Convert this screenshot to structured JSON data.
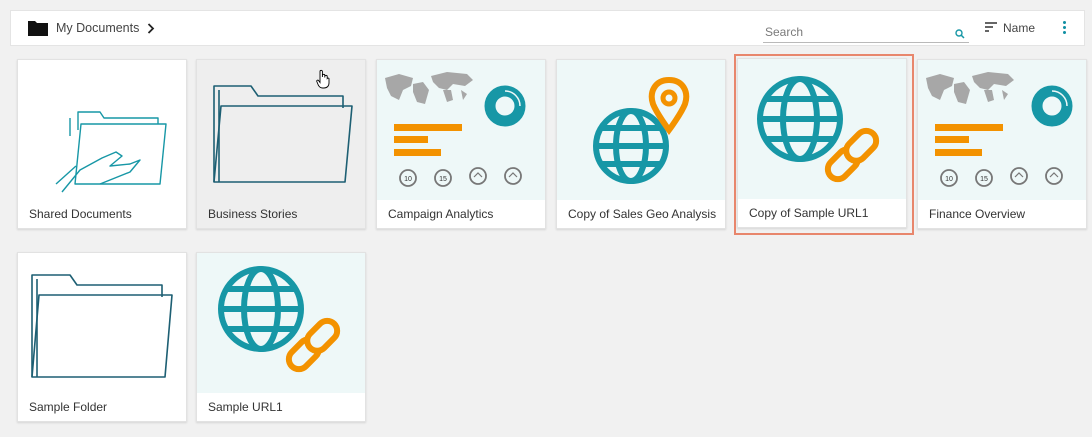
{
  "breadcrumb": {
    "folder_label": "My Documents"
  },
  "search": {
    "placeholder": "Search"
  },
  "sort": {
    "label": "Name"
  },
  "colors": {
    "teal": "#1797a6",
    "orange": "#f39200",
    "grey_map": "#a7a7a7",
    "selection": "#e8866c"
  },
  "items": [
    {
      "label": "Shared Documents",
      "icon": "shared-folder-icon"
    },
    {
      "label": "Business Stories",
      "icon": "folder-icon"
    },
    {
      "label": "Campaign Analytics",
      "icon": "dashboard-thumbnail-icon",
      "gauges": [
        "10",
        "15"
      ]
    },
    {
      "label": "Copy of Sales Geo Analysis",
      "icon": "globe-pin-icon"
    },
    {
      "label": "Copy of Sample URL1",
      "icon": "globe-link-icon",
      "selected": true
    },
    {
      "label": "Finance Overview",
      "icon": "dashboard-thumbnail-icon",
      "gauges": [
        "10",
        "15"
      ]
    },
    {
      "label": "Sample Folder",
      "icon": "folder-icon"
    },
    {
      "label": "Sample URL1",
      "icon": "globe-link-icon"
    }
  ]
}
